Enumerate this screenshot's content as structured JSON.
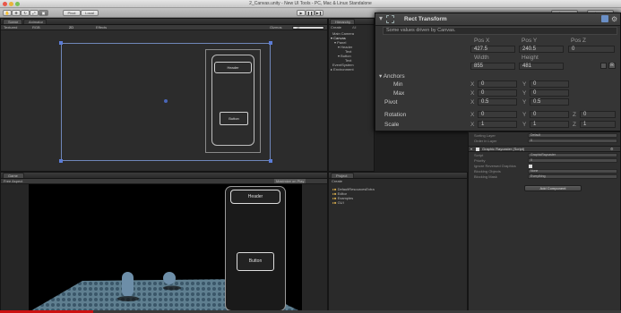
{
  "window": {
    "title": "2_Canvas.unity - New UI Tools - PC, Mac & Linux Standalone"
  },
  "toolbar": {
    "pivot": "Pivot",
    "local": "Local",
    "layers": "Layers",
    "layout": "Layout"
  },
  "scene": {
    "tab_scene": "Scene",
    "tab_animator": "Animator",
    "shading": "Textured",
    "rgb": "RGB",
    "mode_2d": "2D",
    "effects": "Effects",
    "gizmos": "Gizmos",
    "search": "All",
    "canvas_header": "Header",
    "canvas_button": "Button"
  },
  "hierarchy": {
    "tab": "Hierarchy",
    "create": "Create",
    "search": "All",
    "items": [
      "Main Camera",
      "Canvas",
      "Panel",
      "Header",
      "Text",
      "Button",
      "Text",
      "EventSystem",
      "Environment"
    ]
  },
  "rect_transform": {
    "title": "Rect Transform",
    "note": "Some values driven by Canvas.",
    "pos_x_label": "Pos X",
    "pos_y_label": "Pos Y",
    "pos_z_label": "Pos Z",
    "pos_x": "427.5",
    "pos_y": "240.5",
    "pos_z": "0",
    "width_label": "Width",
    "height_label": "Height",
    "width": "855",
    "height": "481",
    "anchors": "Anchors",
    "min_label": "Min",
    "max_label": "Max",
    "pivot_label": "Pivot",
    "min_x": "0",
    "min_y": "0",
    "max_x": "0",
    "max_y": "0",
    "pivot_x": "0.5",
    "pivot_y": "0.5",
    "rotation_label": "Rotation",
    "scale_label": "Scale",
    "rot_x": "0",
    "rot_y": "0",
    "rot_z": "0",
    "scale_x": "1",
    "scale_y": "1",
    "scale_z": "1",
    "x": "X",
    "y": "Y",
    "z": "Z"
  },
  "inspector": {
    "sorting_layer_label": "Sorting Layer",
    "sorting_layer_value": "Default",
    "order_label": "Order in Layer",
    "order_value": "0",
    "component": "Graphic Raycaster (Script)",
    "script_label": "Script",
    "script_value": "GraphicRaycaster",
    "priority_label": "Priority",
    "priority_value": "0",
    "ignore_label": "Ignore Reversed Graphics",
    "blocking_objects_label": "Blocking Objects",
    "blocking_objects_value": "None",
    "blocking_mask_label": "Blocking Mask",
    "blocking_mask_value": "Everything",
    "add_component": "Add Component"
  },
  "game": {
    "tab": "Game",
    "aspect": "Free Aspect",
    "maximize": "Maximize on Play",
    "header": "Header",
    "button": "Button"
  },
  "project": {
    "tab": "Project",
    "create": "Create",
    "folders": [
      "DefaultResourcesExtra",
      "Editor",
      "Examples",
      "GUI"
    ]
  },
  "colors": {
    "accent": "#4a7ac8",
    "video_progress": "#cc1111"
  }
}
